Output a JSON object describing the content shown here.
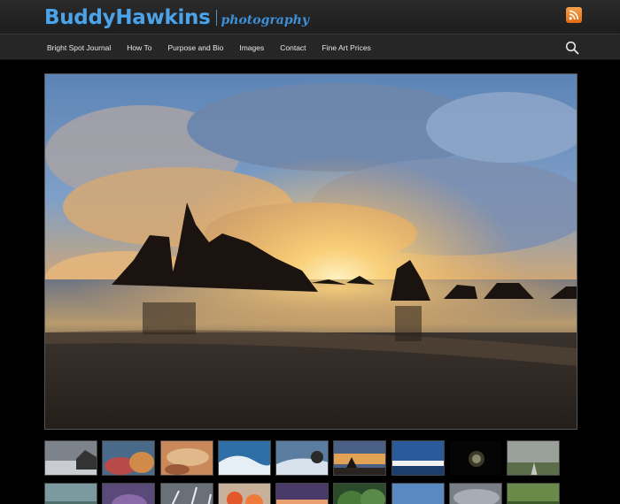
{
  "site": {
    "name": "BuddyHawkins",
    "tagline": "photography"
  },
  "nav": {
    "items": [
      {
        "label": "Bright Spot Journal"
      },
      {
        "label": "How To"
      },
      {
        "label": "Purpose and Bio"
      },
      {
        "label": "Images"
      },
      {
        "label": "Contact"
      },
      {
        "label": "Fine Art Prices"
      }
    ]
  },
  "icons": {
    "rss": "rss-icon",
    "search": "search-icon"
  },
  "colors": {
    "brand": "#4ea3e6",
    "rss": "#f08a2c",
    "background": "#000000"
  },
  "hero": {
    "subject": "sea-stacks-sunset-beach"
  },
  "thumbnails": {
    "row1": [
      {
        "scene": "misty-shore"
      },
      {
        "scene": "colorful-rocks"
      },
      {
        "scene": "warm-rock-abstract"
      },
      {
        "scene": "ocean-wave"
      },
      {
        "scene": "wave-rock"
      },
      {
        "scene": "sunset-sea-stack"
      },
      {
        "scene": "blue-town-coast"
      },
      {
        "scene": "dark-arch"
      },
      {
        "scene": "foggy-road"
      }
    ],
    "row2": [
      {
        "scene": "teal-seascape"
      },
      {
        "scene": "purple-flowers"
      },
      {
        "scene": "white-branches"
      },
      {
        "scene": "orange-flowers"
      },
      {
        "scene": "dusk-horizon"
      },
      {
        "scene": "green-forest"
      },
      {
        "scene": "blue-sky-coast"
      },
      {
        "scene": "grey-cloudscape"
      },
      {
        "scene": "green-field"
      }
    ]
  }
}
